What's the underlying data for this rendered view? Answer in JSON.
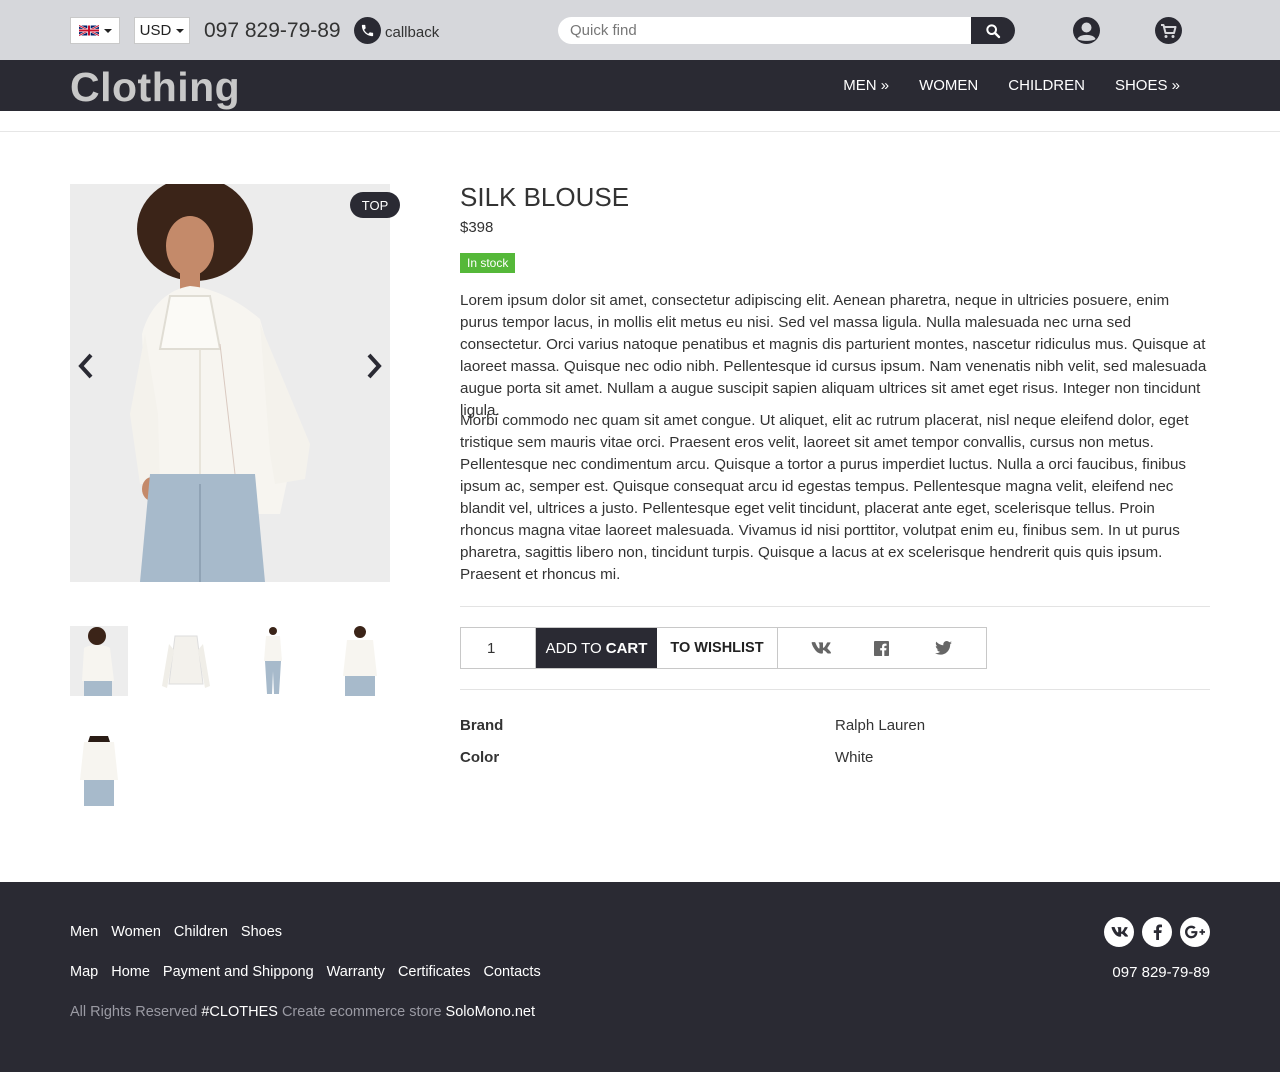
{
  "header": {
    "currency": "USD",
    "phone": "097 829-79-89",
    "callback_label": "callback",
    "search_placeholder": "Quick find"
  },
  "brand": {
    "logo": "Clothing"
  },
  "nav": {
    "items": [
      {
        "label": "MEN »"
      },
      {
        "label": "WOMEN"
      },
      {
        "label": "CHILDREN"
      },
      {
        "label": "SHOES »"
      }
    ]
  },
  "product": {
    "badge": "TOP",
    "title": "SILK BLOUSE",
    "price": "$398",
    "stock": "In stock",
    "description1": "Lorem ipsum dolor sit amet, consectetur adipiscing elit. Aenean pharetra, neque in ultricies posuere, enim purus tempor lacus, in mollis elit metus eu nisi. Sed vel massa ligula. Nulla malesuada nec urna sed consectetur. Orci varius natoque penatibus et magnis dis parturient montes, nascetur ridiculus mus. Quisque at laoreet massa. Quisque nec odio nibh. Pellentesque id cursus ipsum. Nam venenatis nibh velit, sed malesuada augue porta sit amet. Nullam a augue suscipit sapien aliquam ultrices sit amet eget risus. Integer non tincidunt ligula.",
    "description2": "Morbi commodo nec quam sit amet congue. Ut aliquet, elit ac rutrum placerat, nisl neque eleifend dolor, eget tristique sem mauris vitae orci. Praesent eros velit, laoreet sit amet tempor convallis, cursus non metus. Pellentesque nec condimentum arcu. Quisque a tortor a purus imperdiet luctus. Nulla a orci faucibus, finibus ipsum ac, semper est. Quisque consequat arcu id egestas tempus. Pellentesque magna velit, eleifend nec blandit vel, ultrices a justo. Pellentesque eget velit tincidunt, placerat ante eget, scelerisque tellus. Proin rhoncus magna vitae laoreet malesuada. Vivamus id nisi porttitor, volutpat enim eu, finibus sem. In ut purus pharetra, sagittis libero non, tincidunt turpis. Quisque a lacus at ex scelerisque hendrerit quis quis ipsum. Praesent et rhoncus mi.",
    "quantity": "1",
    "add_to_cart_prefix": "ADD TO",
    "add_to_cart_bold": "CART",
    "wishlist": "TO WISHLIST",
    "specs": [
      {
        "label": "Brand",
        "value": "Ralph Lauren"
      },
      {
        "label": "Color",
        "value": "White"
      }
    ]
  },
  "footer": {
    "row1": [
      "Men",
      "Women",
      "Children",
      "Shoes"
    ],
    "row2": [
      "Map",
      "Home",
      "Payment and Shippong",
      "Warranty",
      "Certificates",
      "Contacts"
    ],
    "copy_prefix": "All Rights Reserved",
    "copy_brand": "#CLOTHES",
    "copy_mid": "Create ecommerce store",
    "copy_link": "SoloMono.net",
    "phone": "097 829-79-89"
  },
  "icons": {
    "flag": "uk-flag-icon",
    "phone": "phone-icon",
    "search": "search-icon",
    "user": "user-icon",
    "cart": "cart-icon",
    "prev": "chevron-left-icon",
    "next": "chevron-right-icon",
    "vk": "vk-icon",
    "facebook": "facebook-icon",
    "twitter": "twitter-icon",
    "google_plus": "google-plus-icon"
  },
  "colors": {
    "topbar": "#d6d7db",
    "dark": "#2a2a33",
    "stock": "#55b839"
  }
}
